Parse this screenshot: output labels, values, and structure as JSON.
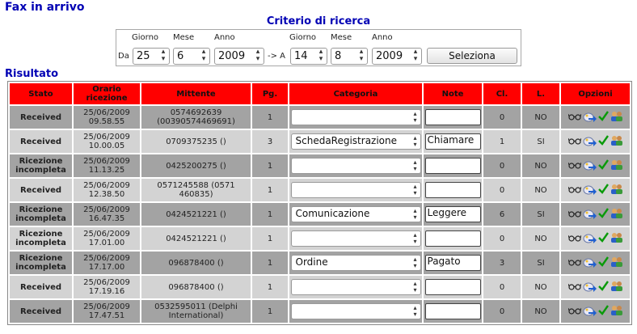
{
  "page": {
    "title": "Fax in arrivo"
  },
  "search": {
    "title": "Criterio di ricerca",
    "from_label": "Da",
    "arrow_text": "-> A",
    "labels": {
      "giorno": "Giorno",
      "mese": "Mese",
      "anno": "Anno"
    },
    "from": {
      "giorno": "25",
      "mese": "6",
      "anno": "2009"
    },
    "to": {
      "giorno": "14",
      "mese": "8",
      "anno": "2009"
    },
    "button_label": "Seleziona"
  },
  "results": {
    "title": "Risultato",
    "headers": {
      "stato": "Stato",
      "orario_1": "Orario",
      "orario_2": "ricezione",
      "mittente": "Mittente",
      "pg": "Pg.",
      "categoria": "Categoria",
      "note": "Note",
      "cl": "Cl.",
      "l": "L.",
      "opzioni": "Opzioni"
    },
    "rows": [
      {
        "stato_1": "Received",
        "stato_2": "",
        "status": "ok",
        "date": "25/06/2009",
        "time": "09.58.55",
        "mitt_1": "0574692639",
        "mitt_2": "(00390574469691)",
        "pg": "1",
        "categoria": "",
        "note": "",
        "cl": "0",
        "l": "NO"
      },
      {
        "stato_1": "Received",
        "stato_2": "",
        "status": "ok",
        "date": "25/06/2009",
        "time": "10.00.05",
        "mitt_1": "0709375235 ()",
        "mitt_2": "",
        "pg": "3",
        "categoria": "SchedaRegistrazione",
        "note": "Chiamare",
        "cl": "1",
        "l": "SI"
      },
      {
        "stato_1": "Ricezione",
        "stato_2": "incompleta",
        "status": "ko",
        "date": "25/06/2009",
        "time": "11.13.25",
        "mitt_1": "0425200275 ()",
        "mitt_2": "",
        "pg": "1",
        "categoria": "",
        "note": "",
        "cl": "0",
        "l": "NO"
      },
      {
        "stato_1": "Received",
        "stato_2": "",
        "status": "ok",
        "date": "25/06/2009",
        "time": "12.38.50",
        "mitt_1": "0571245588 (0571",
        "mitt_2": "460835)",
        "pg": "1",
        "categoria": "",
        "note": "",
        "cl": "0",
        "l": "NO"
      },
      {
        "stato_1": "Ricezione",
        "stato_2": "incompleta",
        "status": "ko",
        "date": "25/06/2009",
        "time": "16.47.35",
        "mitt_1": "0424521221 ()",
        "mitt_2": "",
        "pg": "1",
        "categoria": "Comunicazione",
        "note": "Leggere",
        "cl": "6",
        "l": "SI"
      },
      {
        "stato_1": "Ricezione",
        "stato_2": "incompleta",
        "status": "ko",
        "date": "25/06/2009",
        "time": "17.01.00",
        "mitt_1": "0424521221 ()",
        "mitt_2": "",
        "pg": "1",
        "categoria": "",
        "note": "",
        "cl": "0",
        "l": "NO"
      },
      {
        "stato_1": "Ricezione",
        "stato_2": "incompleta",
        "status": "ko",
        "date": "25/06/2009",
        "time": "17.17.00",
        "mitt_1": "096878400 ()",
        "mitt_2": "",
        "pg": "1",
        "categoria": "Ordine",
        "note": "Pagato",
        "cl": "3",
        "l": "SI"
      },
      {
        "stato_1": "Received",
        "stato_2": "",
        "status": "ok",
        "date": "25/06/2009",
        "time": "17.19.16",
        "mitt_1": "096878400 ()",
        "mitt_2": "",
        "pg": "1",
        "categoria": "",
        "note": "",
        "cl": "0",
        "l": "NO"
      },
      {
        "stato_1": "Received",
        "stato_2": "",
        "status": "ok",
        "date": "25/06/2009",
        "time": "17.47.51",
        "mitt_1": "0532595011 (Delphi",
        "mitt_2": "International)",
        "pg": "1",
        "categoria": "",
        "note": "",
        "cl": "0",
        "l": "NO"
      }
    ],
    "option_icons": [
      "glasses-icon",
      "forward-icon",
      "check-icon",
      "users-icon"
    ]
  },
  "colors": {
    "title_blue": "#0000b4",
    "header_red": "#ff0000",
    "row_dark": "#a3a3a3",
    "row_light": "#d3d3d3",
    "received_green": "#008000",
    "incomplete_red": "#e00000"
  }
}
